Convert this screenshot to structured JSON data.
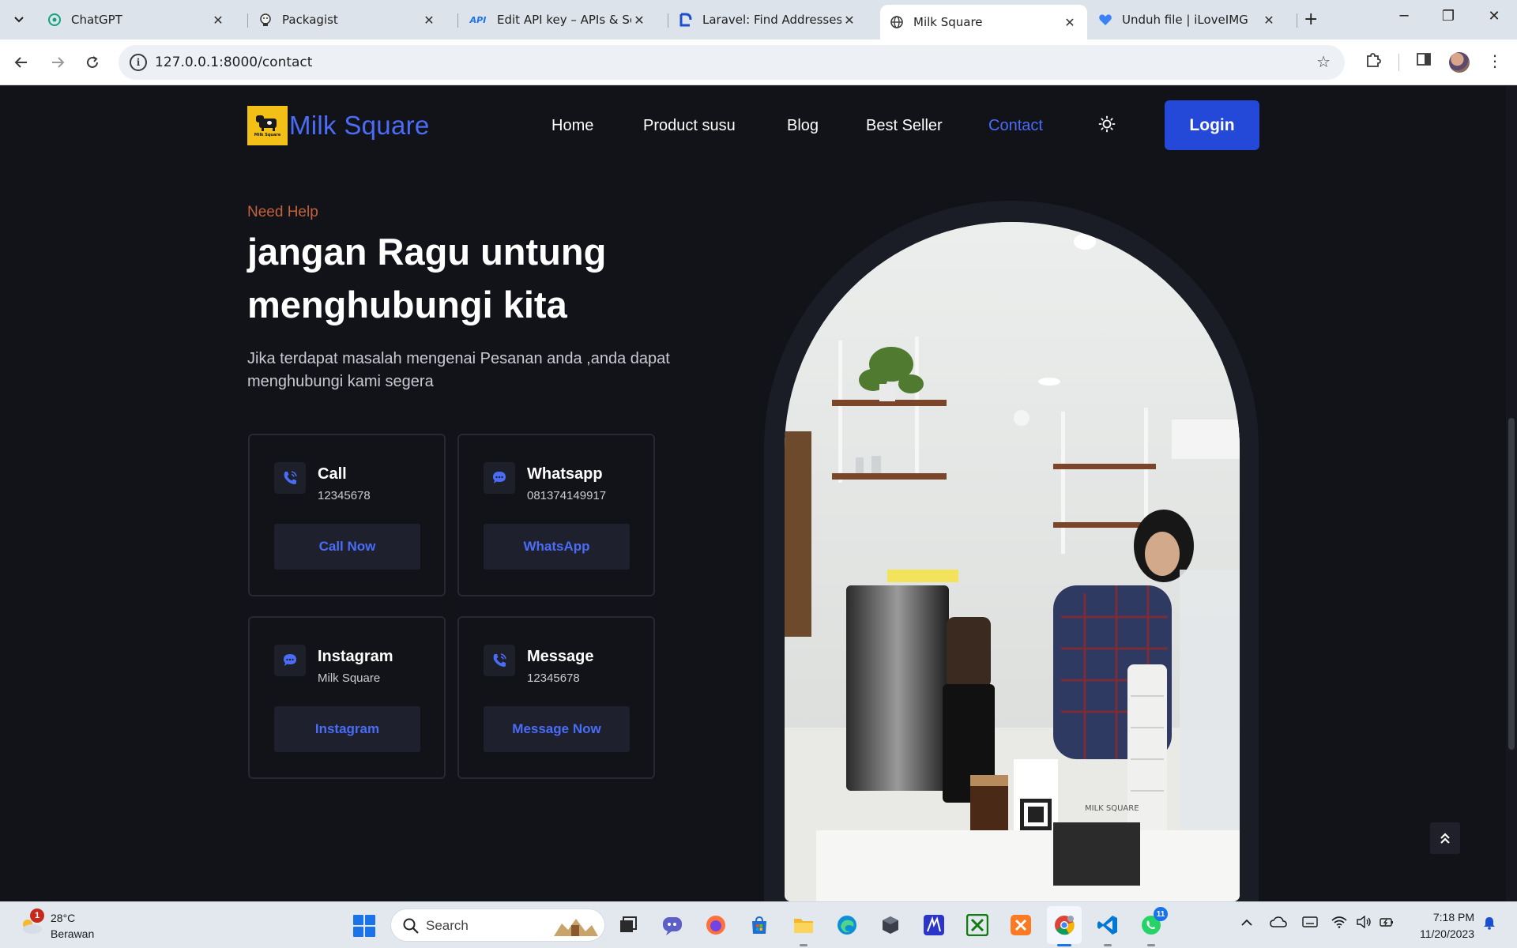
{
  "browser": {
    "tabs": [
      {
        "title": "ChatGPT",
        "favicon": "chatgpt-icon",
        "active": false
      },
      {
        "title": "Packagist",
        "favicon": "packagist-icon",
        "active": false
      },
      {
        "title": "Edit API key – APIs & Servi",
        "favicon": "api-icon",
        "active": false
      },
      {
        "title": "Laravel: Find Addresses wi",
        "favicon": "laravel-doc-icon",
        "active": false
      },
      {
        "title": "Milk Square",
        "favicon": "globe-icon",
        "active": true
      },
      {
        "title": "Unduh file | iLoveIMG",
        "favicon": "heart-icon",
        "active": false
      }
    ],
    "api_favicon_text": "API",
    "url": "127.0.0.1:8000/contact"
  },
  "site": {
    "brand": "Milk Square",
    "logo_caption": "Milk Square",
    "nav": [
      {
        "label": "Home",
        "active": false
      },
      {
        "label": "Product susu",
        "active": false
      },
      {
        "label": "Blog",
        "active": false
      },
      {
        "label": "Best Seller",
        "active": false
      },
      {
        "label": "Contact",
        "active": true
      }
    ],
    "login_label": "Login",
    "accent_color": "#4a6cf7",
    "background_color": "#121319"
  },
  "hero": {
    "eyebrow": "Need Help",
    "headline": "jangan Ragu untung menghubungi kita",
    "lead": "Jika terdapat masalah mengenai Pesanan anda ,anda dapat menghubungi kami segera"
  },
  "contact_cards": [
    {
      "title": "Call",
      "value": "12345678",
      "button": "Call Now",
      "icon": "phone-icon"
    },
    {
      "title": "Whatsapp",
      "value": "081374149917",
      "button": "WhatsApp",
      "icon": "chat-bubble-icon"
    },
    {
      "title": "Instagram",
      "value": "Milk Square",
      "button": "Instagram",
      "icon": "chat-bubble-icon"
    },
    {
      "title": "Message",
      "value": "12345678",
      "button": "Message Now",
      "icon": "phone-icon"
    }
  ],
  "photo": {
    "subject": "cafe-counter-photo",
    "counter_label": "MILK SQUARE"
  },
  "taskbar": {
    "weather_temp": "28°C",
    "weather_condition": "Berawan",
    "weather_badge": "1",
    "search_placeholder": "Search",
    "whatsapp_badge": "11",
    "time": "7:18 PM",
    "date": "11/20/2023"
  }
}
